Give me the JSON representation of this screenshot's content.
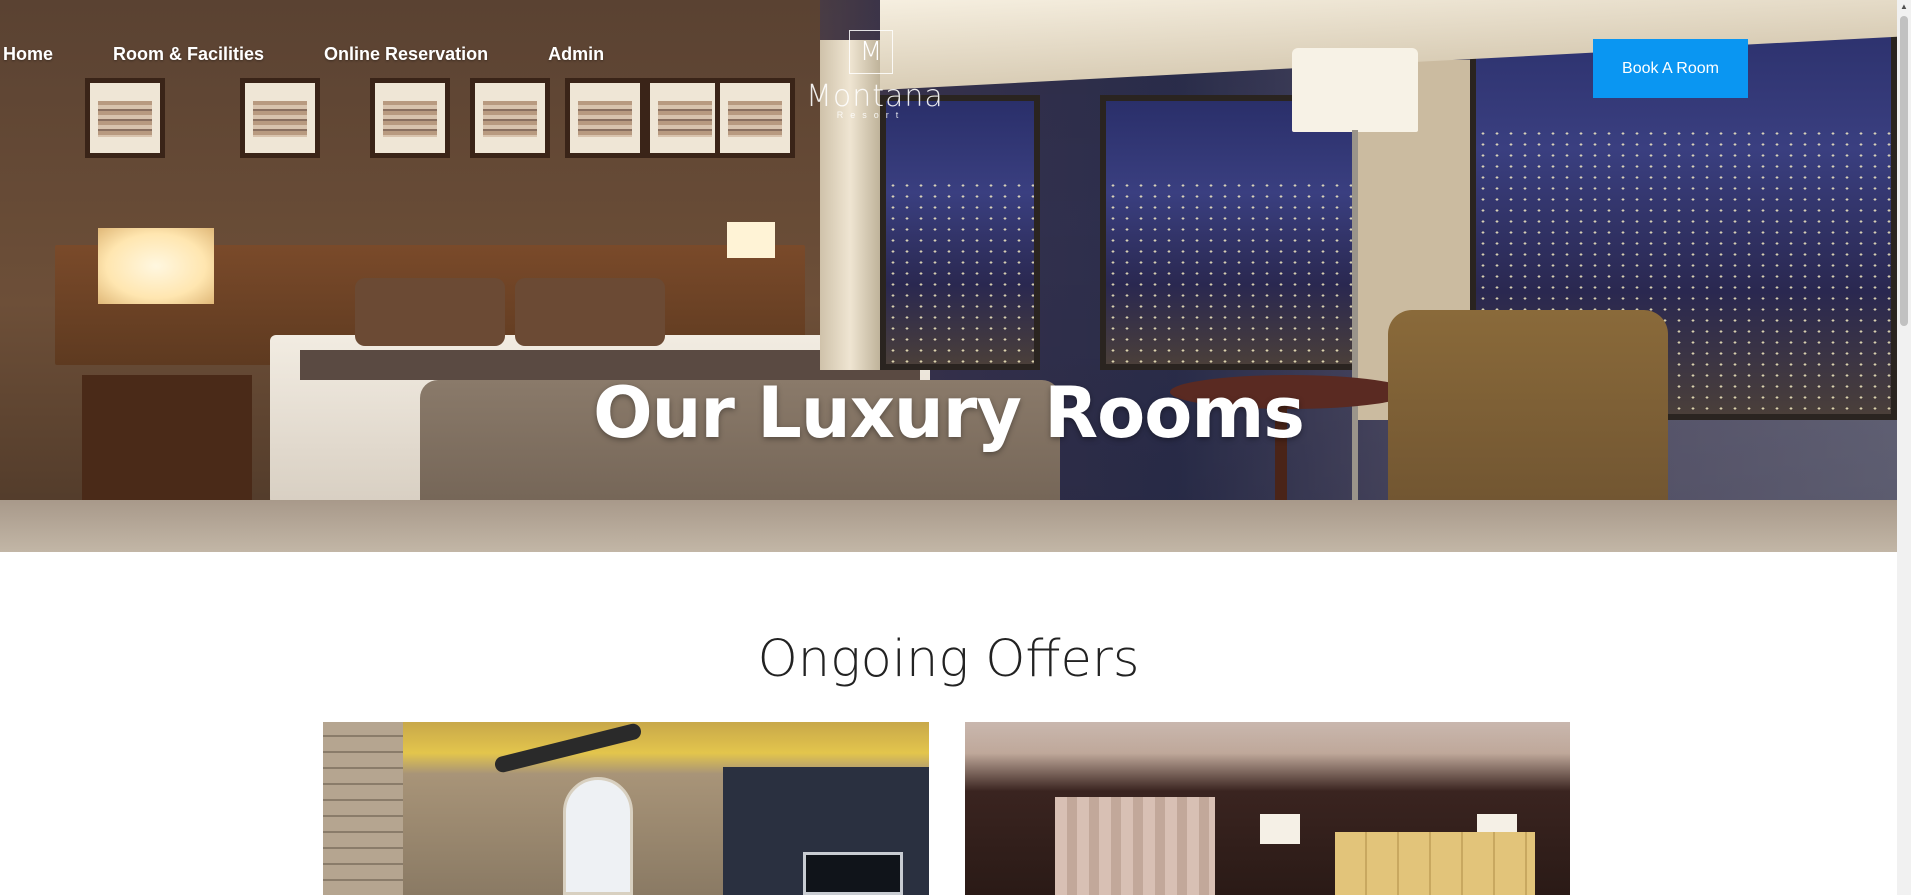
{
  "nav": {
    "items": [
      {
        "label": "Home"
      },
      {
        "label": "Room & Facilities"
      },
      {
        "label": "Online Reservation"
      },
      {
        "label": "Admin"
      }
    ]
  },
  "logo": {
    "letter": "M",
    "name": "Montana",
    "subtitle": "Resort"
  },
  "header": {
    "book_button_label": "Book A Room"
  },
  "hero": {
    "title": "Our Luxury Rooms"
  },
  "offers": {
    "title": "Ongoing Offers"
  },
  "colors": {
    "accent": "#0a96f2",
    "text_dark": "#222222",
    "white": "#ffffff"
  }
}
